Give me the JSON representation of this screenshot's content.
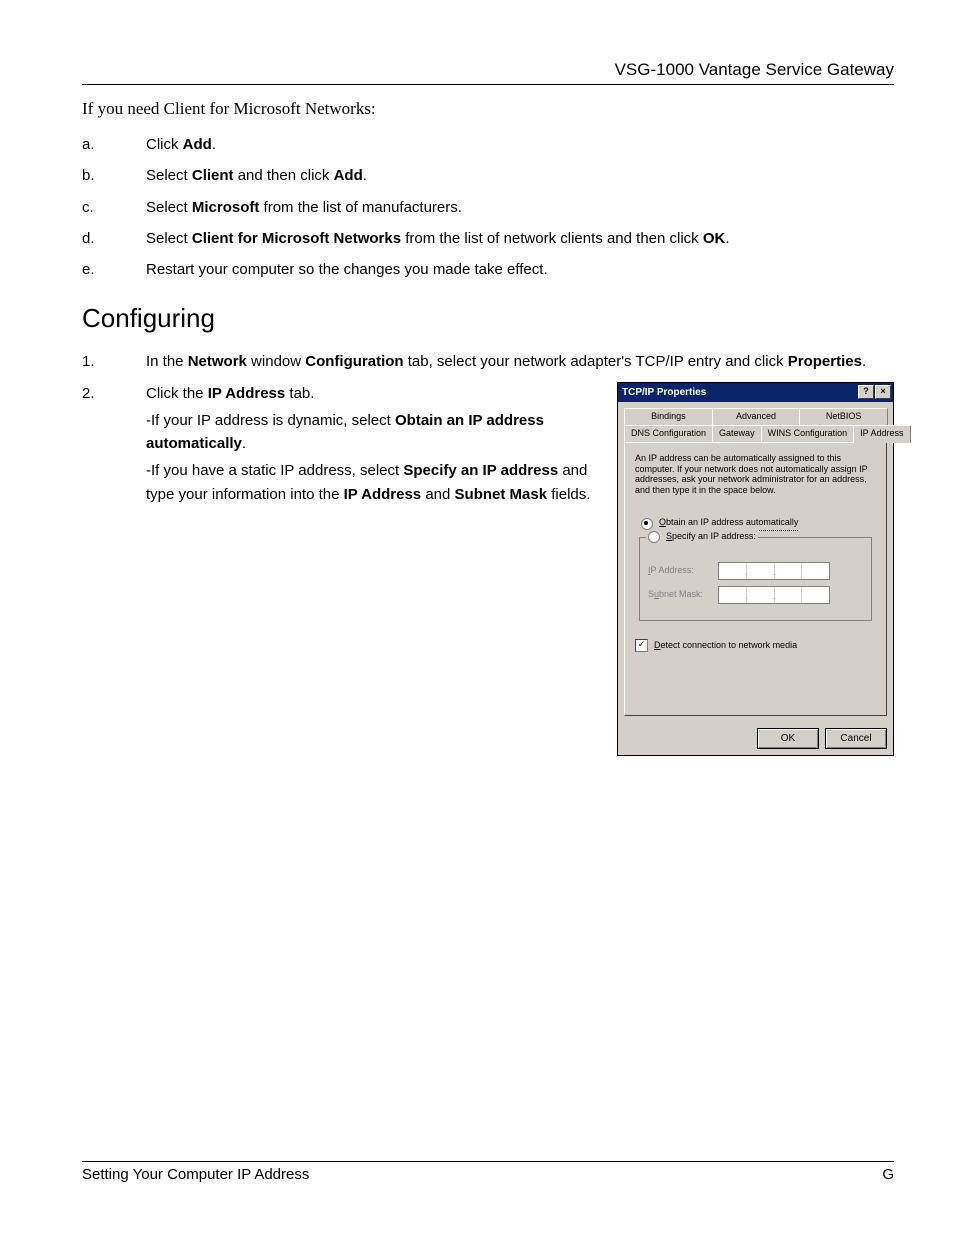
{
  "header": "VSG-1000 Vantage Service Gateway",
  "intro": "If you need Client for Microsoft Networks:",
  "letter_steps": {
    "a": {
      "marker": "a.",
      "pre": "Click ",
      "b1": "Add",
      "post": "."
    },
    "b": {
      "marker": "b.",
      "pre": "Select ",
      "b1": "Client",
      "mid": " and then click ",
      "b2": "Add",
      "post": "."
    },
    "c": {
      "marker": "c.",
      "pre": "Select ",
      "b1": "Microsoft",
      "post": " from the list of manufacturers."
    },
    "d": {
      "marker": "d.",
      "pre": "Select ",
      "b1": "Client for Microsoft Networks",
      "mid": " from the list of network clients and then click ",
      "b2": "OK",
      "post": "."
    },
    "e": {
      "marker": "e.",
      "text": "Restart your computer so the changes you made take effect."
    }
  },
  "section_heading": "Configuring",
  "num_steps": {
    "s1": {
      "marker": "1.",
      "pre": "In the ",
      "b1": "Network",
      "mid1": " window ",
      "b2": "Configuration",
      "mid2": " tab, select your network adapter's TCP/IP entry and click ",
      "b3": "Properties",
      "post": "."
    },
    "s2": {
      "marker": "2.",
      "pre": "Click the ",
      "b1": "IP Address",
      "post": " tab.",
      "sub1_pre": "-If your IP address is dynamic, select ",
      "sub1_b": "Obtain an IP address automatically",
      "sub1_post": ".",
      "sub2_pre": "-If you have a static IP address, select ",
      "sub2_b1": "Specify an IP address",
      "sub2_mid1": " and type your information into the ",
      "sub2_b2": "IP Address",
      "sub2_mid2": " and ",
      "sub2_b3": "Subnet Mask",
      "sub2_post": " fields."
    }
  },
  "dialog": {
    "title": "TCP/IP Properties",
    "help": "?",
    "close": "×",
    "tabs_top": {
      "bindings": "Bindings",
      "advanced": "Advanced",
      "netbios": "NetBIOS"
    },
    "tabs_bottom": {
      "dns": "DNS Configuration",
      "gateway": "Gateway",
      "wins": "WINS Configuration",
      "ip": "IP Address"
    },
    "desc": "An IP address can be automatically assigned to this computer. If your network does not automatically assign IP addresses, ask your network administrator for an address, and then type it in the space below.",
    "radio_obtain_pre": "O",
    "radio_obtain": "btain an IP address automatically",
    "radio_specify_pre": "S",
    "radio_specify": "pecify an IP address:",
    "field_ip_pre": "I",
    "field_ip": "P Address:",
    "field_mask_pre": "S",
    "field_mask_u": "u",
    "field_mask": "bnet Mask:",
    "check_pre": "D",
    "check": "etect connection to network media",
    "ok": "OK",
    "cancel": "Cancel"
  },
  "footer": {
    "left": "Setting Your Computer IP Address",
    "right": "G"
  }
}
